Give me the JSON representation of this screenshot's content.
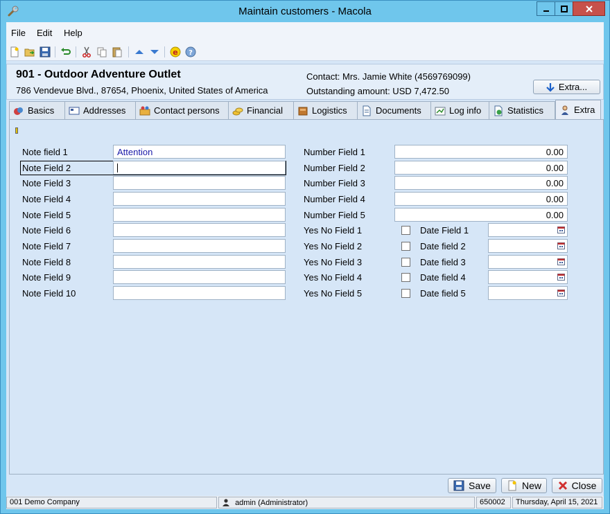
{
  "window": {
    "title": "Maintain customers - Macola",
    "icon": "wrench-icon"
  },
  "menu": {
    "file": "File",
    "edit": "Edit",
    "help": "Help"
  },
  "toolbar": {
    "icons": [
      "new-icon",
      "open-icon",
      "save-icon",
      "undo-icon",
      "cut-icon",
      "copy-icon",
      "paste-icon",
      "previous-icon",
      "next-icon",
      "exact-icon",
      "help-icon"
    ]
  },
  "header": {
    "customer_title": "901 - Outdoor Adventure Outlet",
    "address": "786 Vendevue Blvd., 87654, Phoenix, United States of America",
    "contact": "Contact: Mrs. Jamie White (4569769099)",
    "outstanding": "Outstanding amount: USD 7,472.50",
    "extra_button": "Extra..."
  },
  "tabs": [
    {
      "label": "Basics",
      "icon": "basics-icon"
    },
    {
      "label": "Addresses",
      "icon": "address-card-icon"
    },
    {
      "label": "Contact persons",
      "icon": "contact-persons-icon"
    },
    {
      "label": "Financial",
      "icon": "coins-icon"
    },
    {
      "label": "Logistics",
      "icon": "box-icon"
    },
    {
      "label": "Documents",
      "icon": "document-icon"
    },
    {
      "label": "Log info",
      "icon": "log-icon"
    },
    {
      "label": "Statistics",
      "icon": "statistics-icon"
    },
    {
      "label": "Extra",
      "icon": "person-icon",
      "active": true
    }
  ],
  "note_fields": [
    {
      "label": "Note field 1",
      "value": "Attention"
    },
    {
      "label": "Note Field 2",
      "value": ""
    },
    {
      "label": "Note Field 3",
      "value": ""
    },
    {
      "label": "Note Field 4",
      "value": ""
    },
    {
      "label": "Note Field 5",
      "value": ""
    },
    {
      "label": "Note Field 6",
      "value": ""
    },
    {
      "label": "Note Field 7",
      "value": ""
    },
    {
      "label": "Note Field 8",
      "value": ""
    },
    {
      "label": "Note Field 9",
      "value": ""
    },
    {
      "label": "Note Field 10",
      "value": ""
    }
  ],
  "number_fields": [
    {
      "label": "Number Field 1",
      "value": "0.00"
    },
    {
      "label": "Number Field 2",
      "value": "0.00"
    },
    {
      "label": "Number Field 3",
      "value": "0.00"
    },
    {
      "label": "Number Field 4",
      "value": "0.00"
    },
    {
      "label": "Number Field 5",
      "value": "0.00"
    }
  ],
  "yesno_fields": [
    {
      "label": "Yes No Field 1",
      "checked": false
    },
    {
      "label": "Yes No Field 2",
      "checked": false
    },
    {
      "label": "Yes No Field 3",
      "checked": false
    },
    {
      "label": "Yes No Field 4",
      "checked": false
    },
    {
      "label": "Yes No Field 5",
      "checked": false
    }
  ],
  "date_fields": [
    {
      "label": "Date Field 1",
      "value": ""
    },
    {
      "label": "Date field 2",
      "value": ""
    },
    {
      "label": "Date field 3",
      "value": ""
    },
    {
      "label": "Date field 4",
      "value": ""
    },
    {
      "label": "Date field 5",
      "value": ""
    }
  ],
  "buttons": {
    "save": "Save",
    "new": "New",
    "close": "Close"
  },
  "status": {
    "company": "001 Demo Company",
    "user": "admin (Administrator)",
    "code": "650002",
    "date": "Thursday, April 15, 2021"
  },
  "colors": {
    "titlebar": "#6fc6ec",
    "content_bg": "#d6e6f7",
    "link_text": "#1a1aa8",
    "close_button": "#c7514a"
  }
}
